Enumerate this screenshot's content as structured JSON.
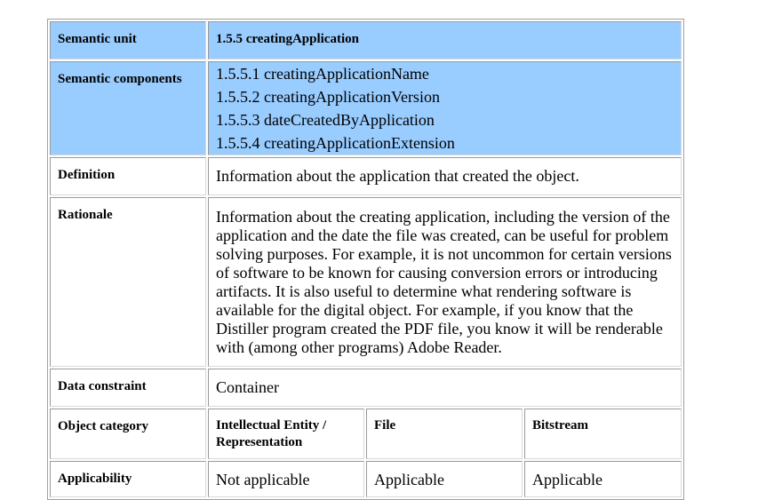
{
  "semantic_unit": {
    "label": "Semantic unit",
    "value": "1.5.5 creatingApplication"
  },
  "semantic_components": {
    "label": "Semantic components",
    "items": [
      "1.5.5.1 creatingApplicationName",
      "1.5.5.2 creatingApplicationVersion",
      "1.5.5.3 dateCreatedByApplication",
      "1.5.5.4 creatingApplicationExtension"
    ]
  },
  "definition": {
    "label": "Definition",
    "value": "Information about the application that created the object."
  },
  "rationale": {
    "label": "Rationale",
    "value": "Information about the creating application, including the version of the application and the date the file was created, can be useful for problem solving purposes. For example, it is not uncommon for certain versions of software to be known for causing conversion errors or introducing artifacts. It is also useful to determine what rendering software is available for the digital object. For example, if you know that the Distiller program created the PDF file, you know it will be renderable with (among other programs) Adobe Reader."
  },
  "data_constraint": {
    "label": "Data constraint",
    "value": "Container"
  },
  "object_category": {
    "label": "Object category",
    "columns": [
      "Intellectual Entity / Representation",
      "File",
      "Bitstream"
    ]
  },
  "applicability": {
    "label": "Applicability",
    "values": [
      "Not applicable",
      "Applicable",
      "Applicable"
    ]
  },
  "colors": {
    "header_background": "#99ccff"
  }
}
